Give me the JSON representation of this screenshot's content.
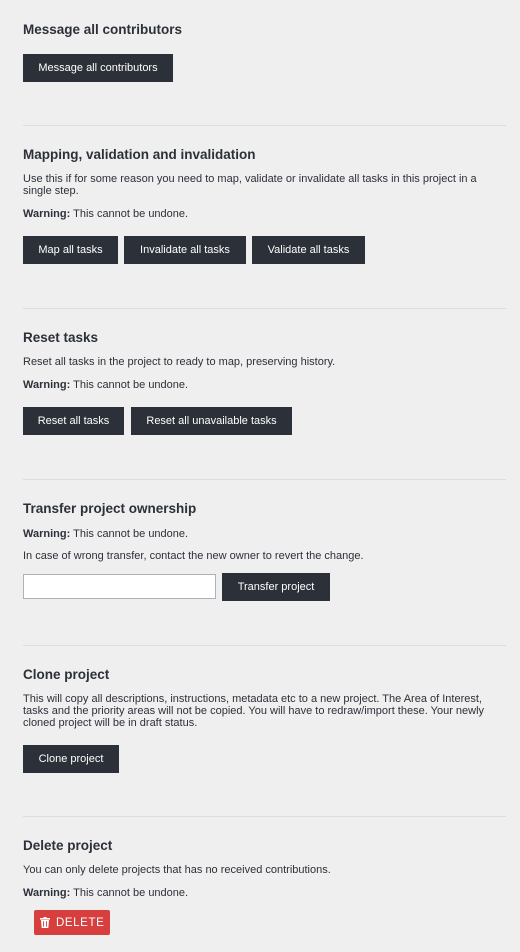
{
  "message": {
    "title": "Message all contributors",
    "button": "Message all contributors"
  },
  "mapping": {
    "title": "Mapping, validation and invalidation",
    "description": "Use this if for some reason you need to map, validate or invalidate all tasks in this project in a single step.",
    "warning_label": "Warning:",
    "warning_text": " This cannot be undone.",
    "buttons": [
      "Map all tasks",
      "Invalidate all tasks",
      "Validate all tasks"
    ]
  },
  "reset": {
    "title": "Reset tasks",
    "description": "Reset all tasks in the project to ready to map, preserving history.",
    "warning_label": "Warning:",
    "warning_text": " This cannot be undone.",
    "buttons": [
      "Reset all tasks",
      "Reset all unavailable tasks"
    ]
  },
  "transfer": {
    "title": "Transfer project ownership",
    "warning_label": "Warning:",
    "warning_text": " This cannot be undone.",
    "description": "In case of wrong transfer, contact the new owner to revert the change.",
    "input_value": "",
    "button": "Transfer project"
  },
  "clone": {
    "title": "Clone project",
    "description": "This will copy all descriptions, instructions, metadata etc to a new project. The Area of Interest, tasks and the priority areas will not be copied. You will have to redraw/import these. Your newly cloned project will be in draft status.",
    "button": "Clone project"
  },
  "delete": {
    "title": "Delete project",
    "description": "You can only delete projects that has no received contributions.",
    "warning_label": "Warning:",
    "warning_text": " This cannot be undone.",
    "button": "DELETE",
    "button_icon": "trash-icon",
    "button_color": "#d73f3f"
  }
}
